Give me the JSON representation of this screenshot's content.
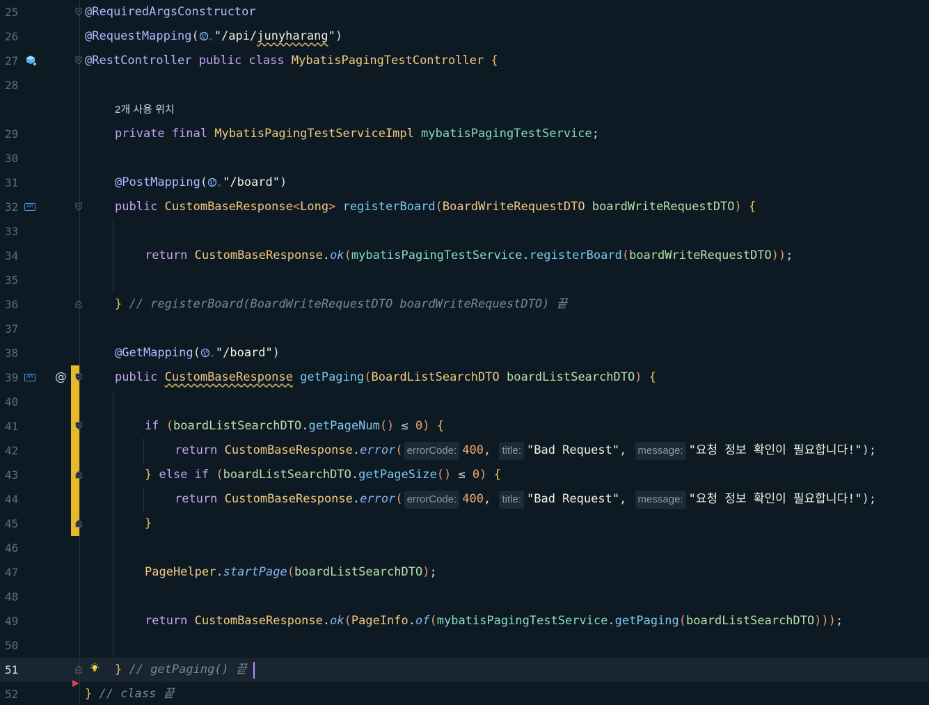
{
  "editor": {
    "current_line": 51,
    "lines": [
      {
        "n": "25",
        "indent": 0,
        "tokens": [
          [
            "@RequiredArgsConstructor",
            "ann"
          ]
        ]
      },
      {
        "n": "26",
        "indent": 0,
        "tokens": [
          [
            "@RequestMapping",
            "ann"
          ],
          [
            "(",
            "punc"
          ],
          [
            "@globe",
            "globe"
          ],
          [
            "\"/api/",
            "str"
          ],
          [
            "junyharang",
            "str-u"
          ],
          [
            "\"",
            "str"
          ],
          [
            ")",
            "punc"
          ]
        ]
      },
      {
        "n": "27",
        "indent": 0,
        "tokens": [
          [
            "@RestController ",
            "ann"
          ],
          [
            "public ",
            "kw"
          ],
          [
            "class ",
            "kw"
          ],
          [
            "MybatisPagingTestController ",
            "type"
          ],
          [
            "{",
            "brace"
          ]
        ]
      },
      {
        "n": "28",
        "indent": 0,
        "tokens": []
      },
      {
        "n": "",
        "indent": 1,
        "hint": true,
        "tokens": [
          [
            "2개 사용 위치",
            "plain"
          ]
        ]
      },
      {
        "n": "29",
        "indent": 1,
        "tokens": [
          [
            "private ",
            "kw"
          ],
          [
            "final ",
            "kw"
          ],
          [
            "MybatisPagingTestServiceImpl ",
            "type"
          ],
          [
            "mybatisPagingTestService",
            "field"
          ],
          [
            ";",
            "punc"
          ]
        ]
      },
      {
        "n": "30",
        "indent": 1,
        "tokens": []
      },
      {
        "n": "31",
        "indent": 1,
        "tokens": [
          [
            "@PostMapping",
            "ann"
          ],
          [
            "(",
            "punc"
          ],
          [
            "@globe",
            "globe"
          ],
          [
            "\"/board\"",
            "str"
          ],
          [
            ")",
            "punc"
          ]
        ]
      },
      {
        "n": "32",
        "indent": 1,
        "tokens": [
          [
            "public ",
            "kw"
          ],
          [
            "CustomBaseResponse",
            "type"
          ],
          [
            "<",
            "paren"
          ],
          [
            "Long",
            "type"
          ],
          [
            "> ",
            "paren"
          ],
          [
            "registerBoard",
            "fn"
          ],
          [
            "(",
            "paren"
          ],
          [
            "BoardWriteRequestDTO ",
            "type"
          ],
          [
            "boardWriteRequestDTO",
            "param"
          ],
          [
            ") ",
            "paren"
          ],
          [
            "{",
            "brace"
          ]
        ]
      },
      {
        "n": "33",
        "indent": 1,
        "tokens": []
      },
      {
        "n": "34",
        "indent": 2,
        "tokens": [
          [
            "return ",
            "kw"
          ],
          [
            "CustomBaseResponse",
            "type"
          ],
          [
            ".",
            "punc"
          ],
          [
            "ok",
            "sm"
          ],
          [
            "(",
            "paren"
          ],
          [
            "mybatisPagingTestService",
            "field"
          ],
          [
            ".",
            "punc"
          ],
          [
            "registerBoard",
            "fn"
          ],
          [
            "(",
            "paren"
          ],
          [
            "boardWriteRequestDTO",
            "param"
          ],
          [
            "))",
            "paren"
          ],
          [
            ";",
            "punc"
          ]
        ]
      },
      {
        "n": "35",
        "indent": 1,
        "tokens": []
      },
      {
        "n": "36",
        "indent": 1,
        "tokens": [
          [
            "} ",
            "brace"
          ],
          [
            "// registerBoard(BoardWriteRequestDTO boardWriteRequestDTO) 끝",
            "cmt"
          ]
        ]
      },
      {
        "n": "37",
        "indent": 1,
        "tokens": []
      },
      {
        "n": "38",
        "indent": 1,
        "tokens": [
          [
            "@GetMapping",
            "ann"
          ],
          [
            "(",
            "punc"
          ],
          [
            "@globe",
            "globe"
          ],
          [
            "\"/board\"",
            "str"
          ],
          [
            ")",
            "punc"
          ]
        ]
      },
      {
        "n": "39",
        "indent": 1,
        "tokens": [
          [
            "public ",
            "kw"
          ],
          [
            "CustomBaseResponse",
            "type-u"
          ],
          [
            " getPaging",
            "fn"
          ],
          [
            "(",
            "paren"
          ],
          [
            "BoardListSearchDTO ",
            "type"
          ],
          [
            "boardListSearchDTO",
            "param"
          ],
          [
            ") ",
            "paren"
          ],
          [
            "{",
            "brace"
          ]
        ]
      },
      {
        "n": "40",
        "indent": 1,
        "tokens": []
      },
      {
        "n": "41",
        "indent": 2,
        "tokens": [
          [
            "if ",
            "kw"
          ],
          [
            "(",
            "paren"
          ],
          [
            "boardListSearchDTO",
            "param"
          ],
          [
            ".",
            "punc"
          ],
          [
            "getPageNum",
            "fn"
          ],
          [
            "()",
            "paren"
          ],
          [
            " ≤ ",
            "op"
          ],
          [
            "0",
            "num"
          ],
          [
            ") ",
            "paren"
          ],
          [
            "{",
            "brace"
          ]
        ]
      },
      {
        "n": "42",
        "indent": 3,
        "tokens": [
          [
            "return ",
            "kw"
          ],
          [
            "CustomBaseResponse",
            "type"
          ],
          [
            ".",
            "punc"
          ],
          [
            "error",
            "sm"
          ],
          [
            "(",
            "paren"
          ],
          [
            "errorCode:",
            "hint"
          ],
          [
            "400",
            "num"
          ],
          [
            ", ",
            "punc"
          ],
          [
            "title:",
            "hint"
          ],
          [
            "\"Bad Request\"",
            "str"
          ],
          [
            ", ",
            "punc"
          ],
          [
            "message:",
            "hint"
          ],
          [
            "\"요청 정보 확인이 필요합니다!\"",
            "str"
          ],
          [
            ");",
            "punc"
          ]
        ]
      },
      {
        "n": "43",
        "indent": 2,
        "tokens": [
          [
            "} ",
            "brace"
          ],
          [
            "else ",
            "kw"
          ],
          [
            "if ",
            "kw"
          ],
          [
            "(",
            "paren"
          ],
          [
            "boardListSearchDTO",
            "param"
          ],
          [
            ".",
            "punc"
          ],
          [
            "getPageSize",
            "fn"
          ],
          [
            "()",
            "paren"
          ],
          [
            " ≤ ",
            "op"
          ],
          [
            "0",
            "num"
          ],
          [
            ") ",
            "paren"
          ],
          [
            "{",
            "brace"
          ]
        ]
      },
      {
        "n": "44",
        "indent": 3,
        "tokens": [
          [
            "return ",
            "kw"
          ],
          [
            "CustomBaseResponse",
            "type"
          ],
          [
            ".",
            "punc"
          ],
          [
            "error",
            "sm"
          ],
          [
            "(",
            "paren"
          ],
          [
            "errorCode:",
            "hint"
          ],
          [
            "400",
            "num"
          ],
          [
            ", ",
            "punc"
          ],
          [
            "title:",
            "hint"
          ],
          [
            "\"Bad Request\"",
            "str"
          ],
          [
            ", ",
            "punc"
          ],
          [
            "message:",
            "hint"
          ],
          [
            "\"요청 정보 확인이 필요합니다!\"",
            "str"
          ],
          [
            ");",
            "punc"
          ]
        ]
      },
      {
        "n": "45",
        "indent": 2,
        "tokens": [
          [
            "}",
            "brace"
          ]
        ]
      },
      {
        "n": "46",
        "indent": 2,
        "tokens": []
      },
      {
        "n": "47",
        "indent": 2,
        "tokens": [
          [
            "PageHelper",
            "type"
          ],
          [
            ".",
            "punc"
          ],
          [
            "startPage",
            "sm"
          ],
          [
            "(",
            "paren"
          ],
          [
            "boardListSearchDTO",
            "param"
          ],
          [
            ")",
            "paren"
          ],
          [
            ";",
            "punc"
          ]
        ]
      },
      {
        "n": "48",
        "indent": 2,
        "tokens": []
      },
      {
        "n": "49",
        "indent": 2,
        "tokens": [
          [
            "return ",
            "kw"
          ],
          [
            "CustomBaseResponse",
            "type"
          ],
          [
            ".",
            "punc"
          ],
          [
            "ok",
            "sm"
          ],
          [
            "(",
            "paren"
          ],
          [
            "PageInfo",
            "type"
          ],
          [
            ".",
            "punc"
          ],
          [
            "of",
            "sm"
          ],
          [
            "(",
            "paren"
          ],
          [
            "mybatisPagingTestService",
            "field"
          ],
          [
            ".",
            "punc"
          ],
          [
            "getPaging",
            "fn"
          ],
          [
            "(",
            "paren"
          ],
          [
            "boardListSearchDTO",
            "param"
          ],
          [
            ")))",
            "paren"
          ],
          [
            ";",
            "punc"
          ]
        ]
      },
      {
        "n": "50",
        "indent": 2,
        "tokens": []
      },
      {
        "n": "51",
        "indent": 1,
        "tokens": [
          [
            "} ",
            "brace"
          ],
          [
            "// getPaging() 끝",
            "cmt"
          ]
        ]
      },
      {
        "n": "52",
        "indent": 0,
        "tokens": [
          [
            "} ",
            "brace"
          ],
          [
            "// class 끝",
            "cmt"
          ]
        ]
      }
    ]
  },
  "gutter": {
    "api_badge": "API",
    "at_marker": "@"
  },
  "icons": {
    "bean": "bean-icon",
    "api": "api-endpoint-icon",
    "globe": "globe-icon",
    "bulb": "lightbulb-icon",
    "breakpoint": "run-arrow-icon"
  }
}
